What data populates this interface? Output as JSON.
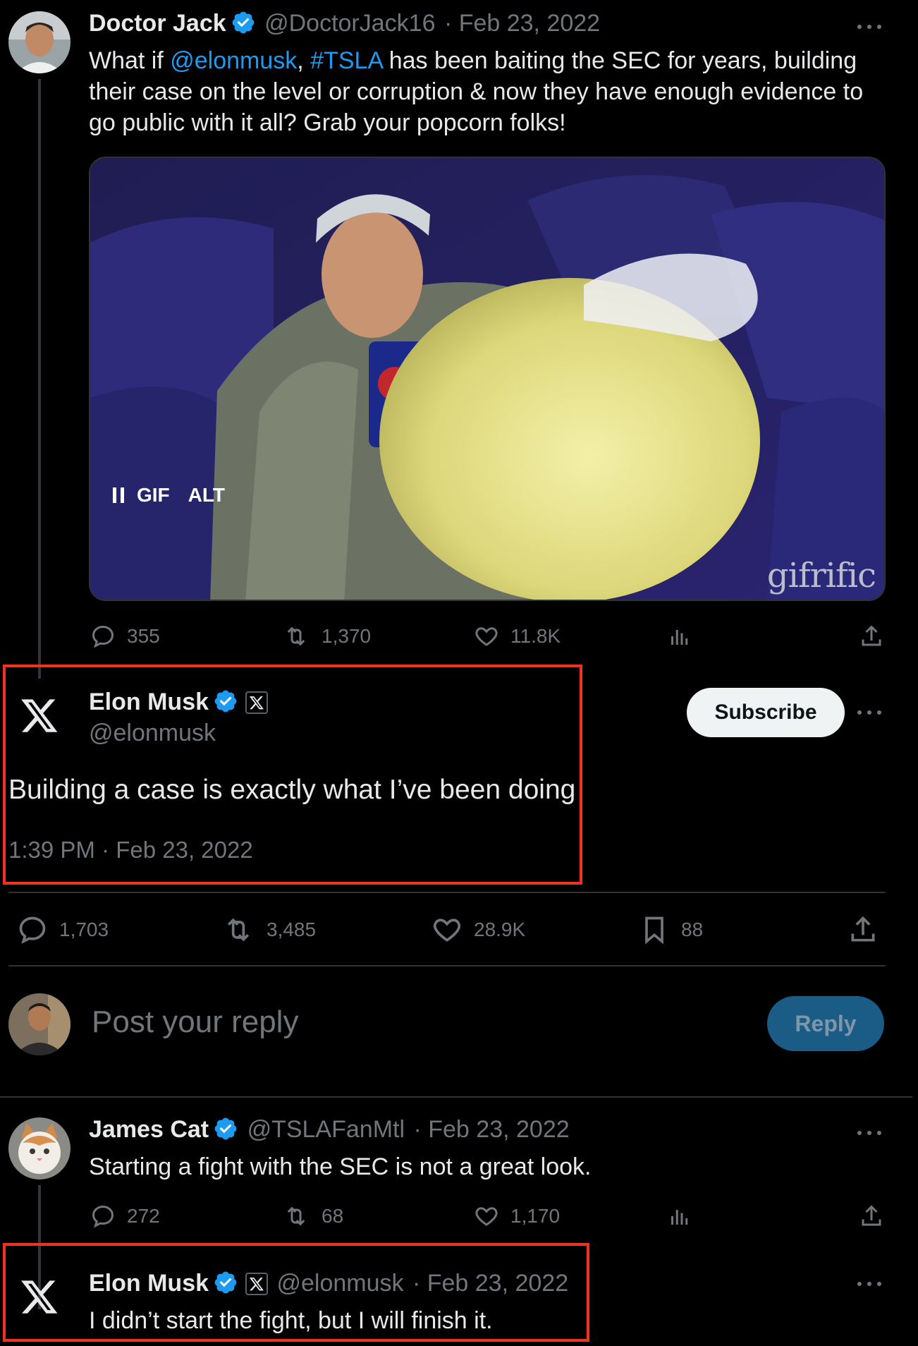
{
  "tweet1": {
    "name": "Doctor Jack",
    "handle": "@DoctorJack16",
    "date": "· Feb 23, 2022",
    "text_prefix": "What if ",
    "mention": "@elonmusk",
    "comma": ", ",
    "hashtag": "#TSLA",
    "text_line1_rest": " has been baiting the SEC for years, building",
    "text_line2": "their case on the level or corruption & now they have enough evidence to",
    "text_line3": "go public with it all? Grab your popcorn folks!",
    "media": {
      "gif_label": "GIF",
      "alt_label": "ALT",
      "watermark": "gifrific"
    },
    "stats": {
      "replies": "355",
      "reposts": "1,370",
      "likes": "11.8K"
    }
  },
  "main_tweet": {
    "name": "Elon Musk",
    "handle": "@elonmusk",
    "subscribe_label": "Subscribe",
    "text": "Building a case is exactly what I’ve been doing",
    "timestamp": "1:39 PM · Feb 23, 2022",
    "stats": {
      "replies": "1,703",
      "reposts": "3,485",
      "likes": "28.9K",
      "bookmarks": "88"
    }
  },
  "composer": {
    "placeholder": "Post your reply",
    "reply_label": "Reply"
  },
  "reply1": {
    "name": "James Cat",
    "handle": "@TSLAFanMtl",
    "date": "· Feb 23, 2022",
    "text": "Starting a fight with the SEC is not a great look.",
    "stats": {
      "replies": "272",
      "reposts": "68",
      "likes": "1,170"
    }
  },
  "reply2": {
    "name": "Elon Musk",
    "handle": "@elonmusk",
    "date": "· Feb 23, 2022",
    "text": "I didn’t start the fight, but I will finish it."
  },
  "colors": {
    "accent": "#1d9bf0",
    "highlight": "#f4311f",
    "background": "#000000"
  }
}
